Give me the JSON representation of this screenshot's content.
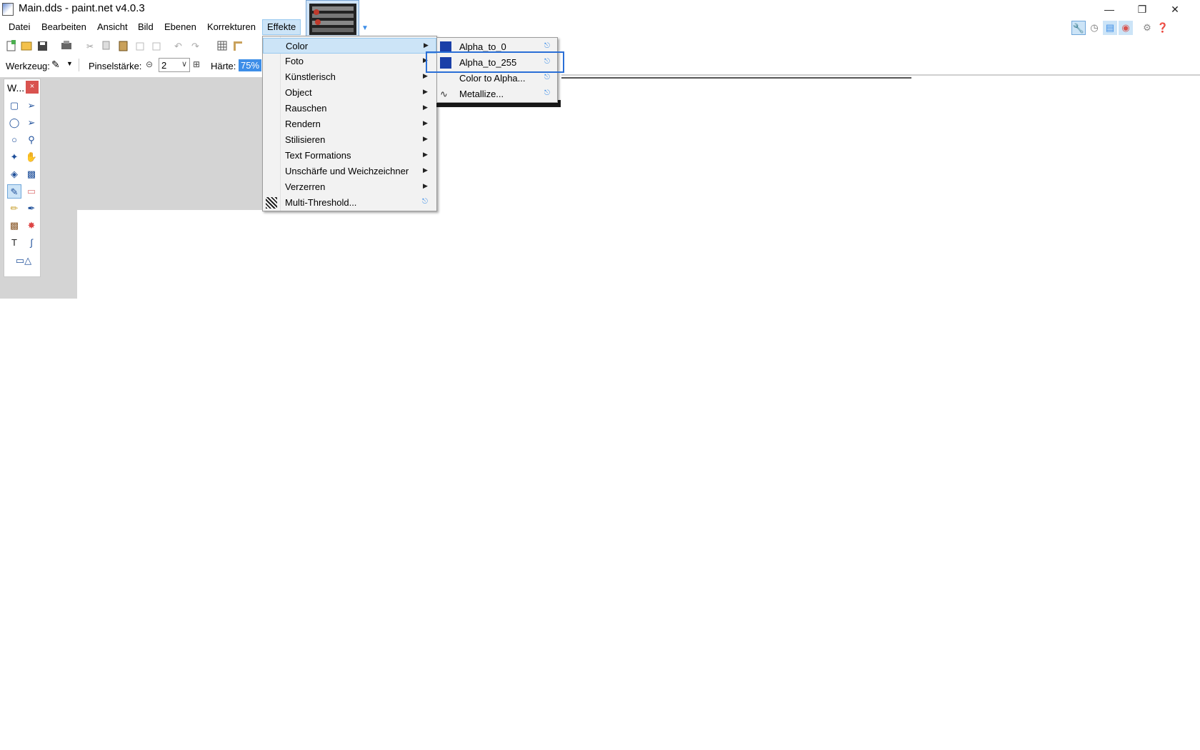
{
  "window": {
    "title": "Main.dds - paint.net v4.0.3",
    "minimize": "—",
    "restore": "❐",
    "close": "✕"
  },
  "menubar": {
    "items": [
      "Datei",
      "Bearbeiten",
      "Ansicht",
      "Bild",
      "Ebenen",
      "Korrekturen",
      "Effekte"
    ]
  },
  "toolbar2": {
    "tool_label": "Werkzeug:",
    "brush_label": "Pinselstärke:",
    "brush_value": "2",
    "hardness_label": "Härte:",
    "hardness_value": "75%"
  },
  "tools_window": {
    "title": "W...",
    "close": "×"
  },
  "effects_menu": {
    "items": [
      {
        "label": "Color",
        "has_submenu": true,
        "highlighted": true
      },
      {
        "label": "Foto",
        "has_submenu": true
      },
      {
        "label": "Künstlerisch",
        "has_submenu": true
      },
      {
        "label": "Object",
        "has_submenu": true
      },
      {
        "label": "Rauschen",
        "has_submenu": true
      },
      {
        "label": "Rendern",
        "has_submenu": true
      },
      {
        "label": "Stilisieren",
        "has_submenu": true
      },
      {
        "label": "Text Formations",
        "has_submenu": true
      },
      {
        "label": "Unschärfe und Weichzeichner",
        "has_submenu": true
      },
      {
        "label": "Verzerren",
        "has_submenu": true
      },
      {
        "label": "Multi-Threshold...",
        "has_submenu": false
      }
    ]
  },
  "color_submenu": {
    "items": [
      {
        "label": "Alpha_to_0"
      },
      {
        "label": "Alpha_to_255",
        "focused": true
      },
      {
        "label": "Color to Alpha..."
      },
      {
        "label": "Metallize..."
      }
    ]
  },
  "colors": {
    "highlight": "#cce4f7",
    "focus": "#2a6fd6",
    "workspace": "#d4d4d4"
  }
}
